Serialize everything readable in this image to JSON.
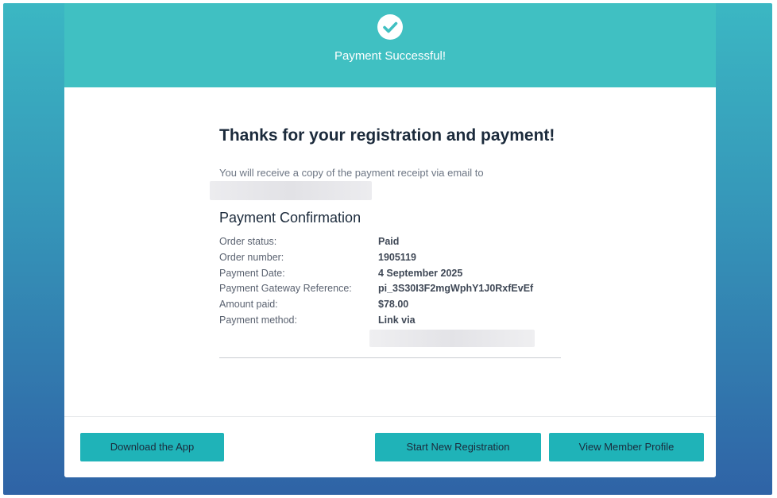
{
  "header": {
    "icon": "check-circle-icon",
    "title": "Payment Successful!"
  },
  "main": {
    "heading": "Thanks for your registration and payment!",
    "receipt_text": "You will receive a copy of the payment receipt via email to",
    "confirmation_title": "Payment Confirmation",
    "details": [
      {
        "label": "Order status:",
        "value": "Paid"
      },
      {
        "label": "Order number:",
        "value": "1905119"
      },
      {
        "label": "Payment Date:",
        "value": "4 September 2025"
      },
      {
        "label": "Payment Gateway Reference:",
        "value": "pi_3S30I3F2mgWphY1J0RxfEvEf"
      },
      {
        "label": "Amount paid:",
        "value": "$78.00"
      },
      {
        "label": "Payment method:",
        "value": "Link via"
      }
    ]
  },
  "footer": {
    "download_label": "Download the App",
    "new_registration_label": "Start New Registration",
    "profile_label": "View Member Profile"
  },
  "colors": {
    "header": "#40c0c2",
    "button": "#1fb3b8",
    "background_top": "#3bb7c3",
    "background_bottom": "#2f63a6"
  }
}
